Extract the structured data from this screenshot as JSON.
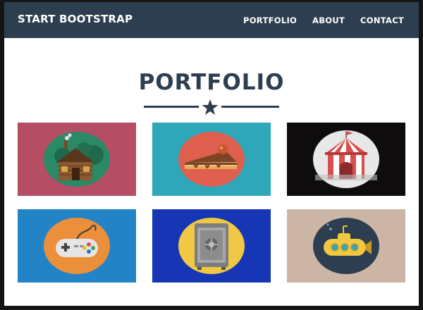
{
  "navbar": {
    "brand": "START BOOTSTRAP",
    "links": [
      "PORTFOLIO",
      "ABOUT",
      "CONTACT"
    ]
  },
  "portfolio": {
    "title": "PORTFOLIO",
    "items": [
      {
        "icon": "cabin-icon",
        "bg": "#b54e65",
        "circle": "#2a8a66"
      },
      {
        "icon": "cake-icon",
        "bg": "#2fa7bb",
        "circle": "#df5f4e"
      },
      {
        "icon": "circus-tent-icon",
        "bg": "#0e0c0c",
        "circle": "#e8e8e8"
      },
      {
        "icon": "game-controller-icon",
        "bg": "#2283c7",
        "circle": "#ec8f3a"
      },
      {
        "icon": "safe-icon",
        "bg": "#1636b5",
        "circle": "#f0c843"
      },
      {
        "icon": "submarine-icon",
        "bg": "#cdb5a6",
        "circle": "#2d3e50"
      }
    ]
  },
  "colors": {
    "navbar": "#2c3e50",
    "text": "#2c3e50",
    "white": "#ffffff"
  }
}
